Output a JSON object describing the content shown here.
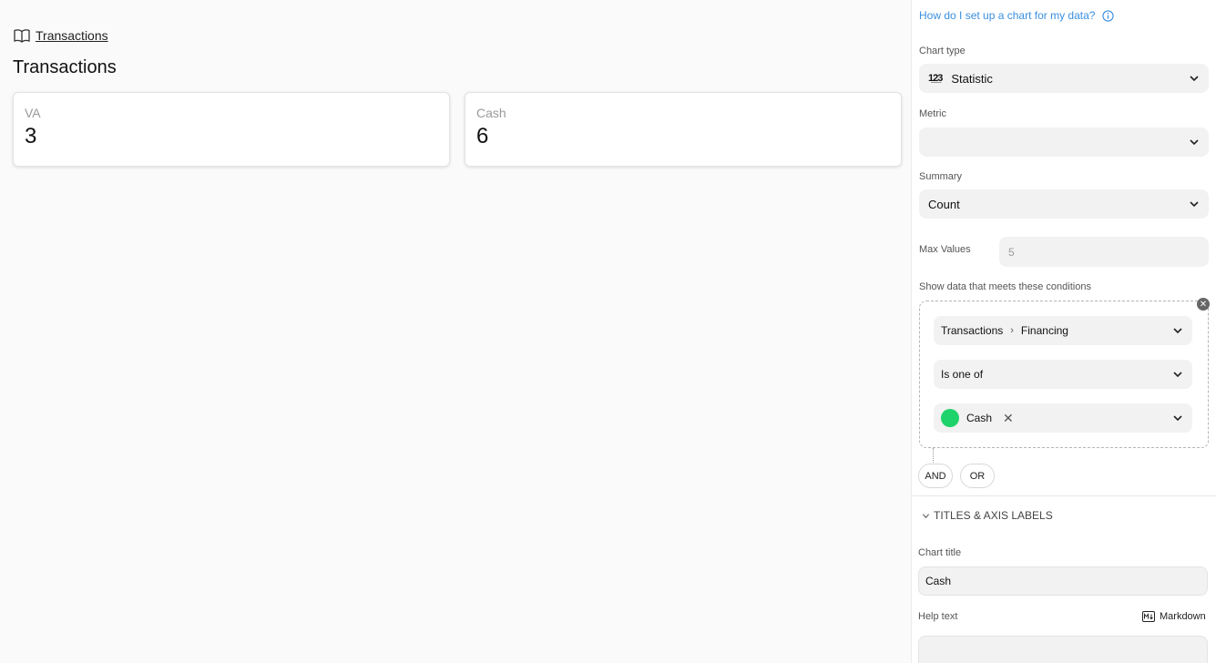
{
  "breadcrumb": {
    "label": "Transactions"
  },
  "page": {
    "title": "Transactions"
  },
  "cards": [
    {
      "label": "VA",
      "value": "3"
    },
    {
      "label": "Cash",
      "value": "6"
    }
  ],
  "panel": {
    "help_link": "How do I set up a chart for my data?",
    "chart_type": {
      "label": "Chart type",
      "value": "Statistic",
      "icon": "statistic-icon"
    },
    "metric": {
      "label": "Metric",
      "value": ""
    },
    "summary": {
      "label": "Summary",
      "value": "Count"
    },
    "max_values": {
      "label": "Max Values",
      "placeholder": "5"
    },
    "conditions": {
      "label": "Show data that meets these conditions",
      "field_table": "Transactions",
      "field_column": "Financing",
      "operator": "Is one of",
      "value_tag": "Cash",
      "value_color": "#1ed36b"
    },
    "and_label": "AND",
    "or_label": "OR",
    "titles_section": "TITLES & AXIS LABELS",
    "chart_title": {
      "label": "Chart title",
      "value": "Cash"
    },
    "help_text": {
      "label": "Help text",
      "value": ""
    },
    "markdown_label": "Markdown"
  },
  "colors": {
    "link": "#3a8fe0",
    "accent_green": "#1ed36b"
  }
}
